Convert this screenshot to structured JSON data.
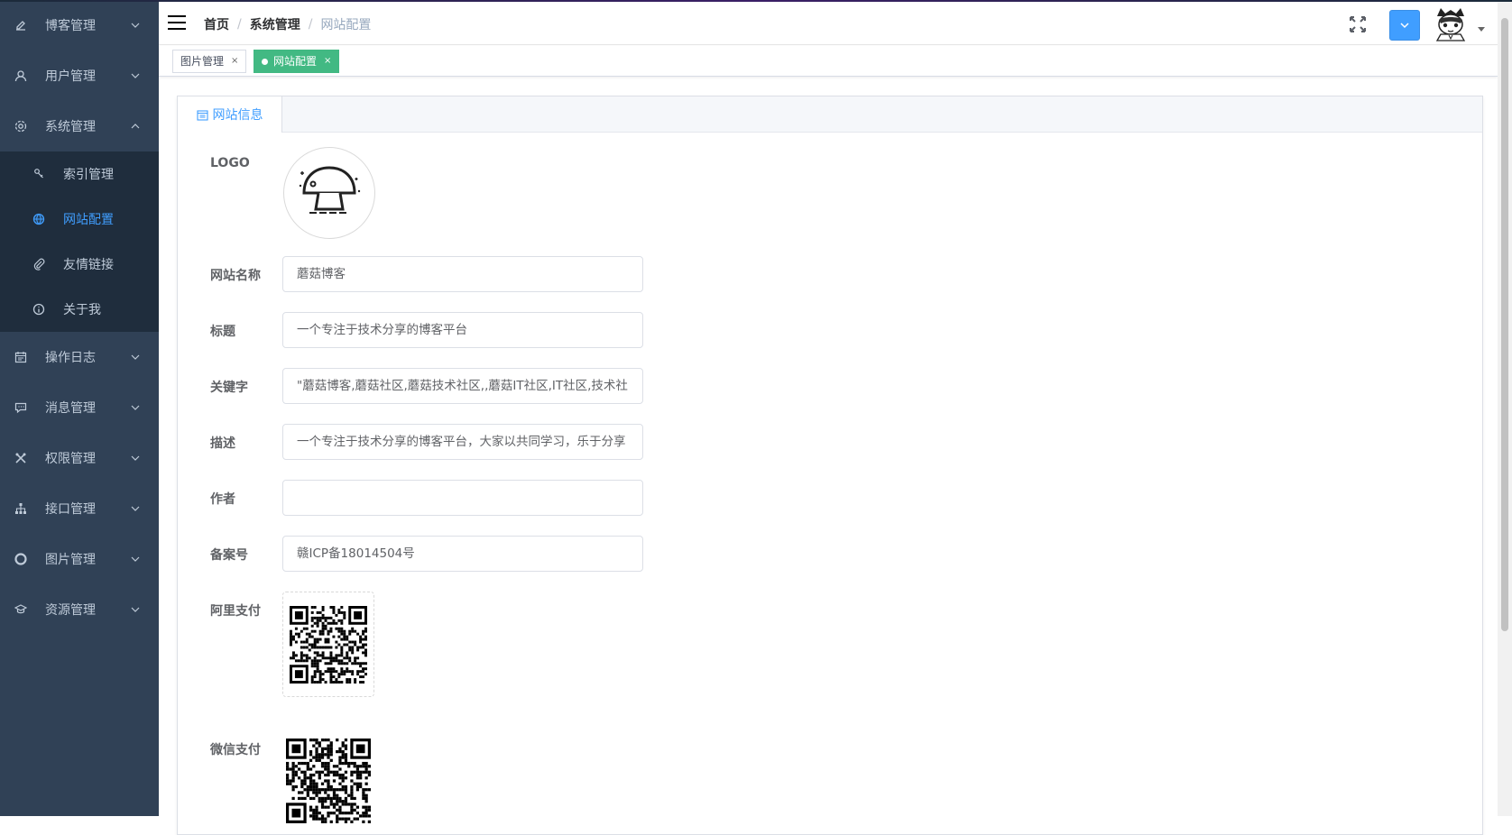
{
  "sidebar": {
    "items": [
      {
        "label": "博客管理",
        "icon": "edit-icon"
      },
      {
        "label": "用户管理",
        "icon": "user-icon"
      },
      {
        "label": "系统管理",
        "icon": "gear-icon",
        "expanded": true
      },
      {
        "label": "操作日志",
        "icon": "calendar-icon"
      },
      {
        "label": "消息管理",
        "icon": "message-icon"
      },
      {
        "label": "权限管理",
        "icon": "tools-icon"
      },
      {
        "label": "接口管理",
        "icon": "sitemap-icon"
      },
      {
        "label": "图片管理",
        "icon": "lifebuoy-icon"
      },
      {
        "label": "资源管理",
        "icon": "graduation-cap-icon"
      }
    ],
    "sub_items": [
      {
        "label": "索引管理",
        "icon": "index-icon"
      },
      {
        "label": "网站配置",
        "icon": "globe-icon",
        "active": true
      },
      {
        "label": "友情链接",
        "icon": "paperclip-icon"
      },
      {
        "label": "关于我",
        "icon": "info-icon"
      }
    ]
  },
  "navbar": {
    "breadcrumb": [
      "首页",
      "系统管理",
      "网站配置"
    ]
  },
  "tags": [
    {
      "label": "图片管理",
      "close": "×"
    },
    {
      "label": "网站配置",
      "close": "×",
      "active": true
    }
  ],
  "card": {
    "tab_label": "网站信息"
  },
  "form": {
    "logo_label": "LOGO",
    "site_name_label": "网站名称",
    "site_name": "蘑菇博客",
    "title_label": "标题",
    "title": "一个专注于技术分享的博客平台",
    "keywords_label": "关键字",
    "keywords": "\"蘑菇博客,蘑菇社区,蘑菇技术社区,,蘑菇IT社区,IT社区,技术社",
    "description_label": "描述",
    "description": "一个专注于技术分享的博客平台，大家以共同学习，乐于分享",
    "author_label": "作者",
    "author": "",
    "record_label": "备案号",
    "record_no": "赣ICP备18014504号",
    "alipay_label": "阿里支付",
    "wechat_label": "微信支付"
  },
  "colors": {
    "sidebar_bg": "#304156",
    "submenu_bg": "#1f2d3d",
    "active_blue": "#409eff",
    "tag_green": "#42b983"
  }
}
